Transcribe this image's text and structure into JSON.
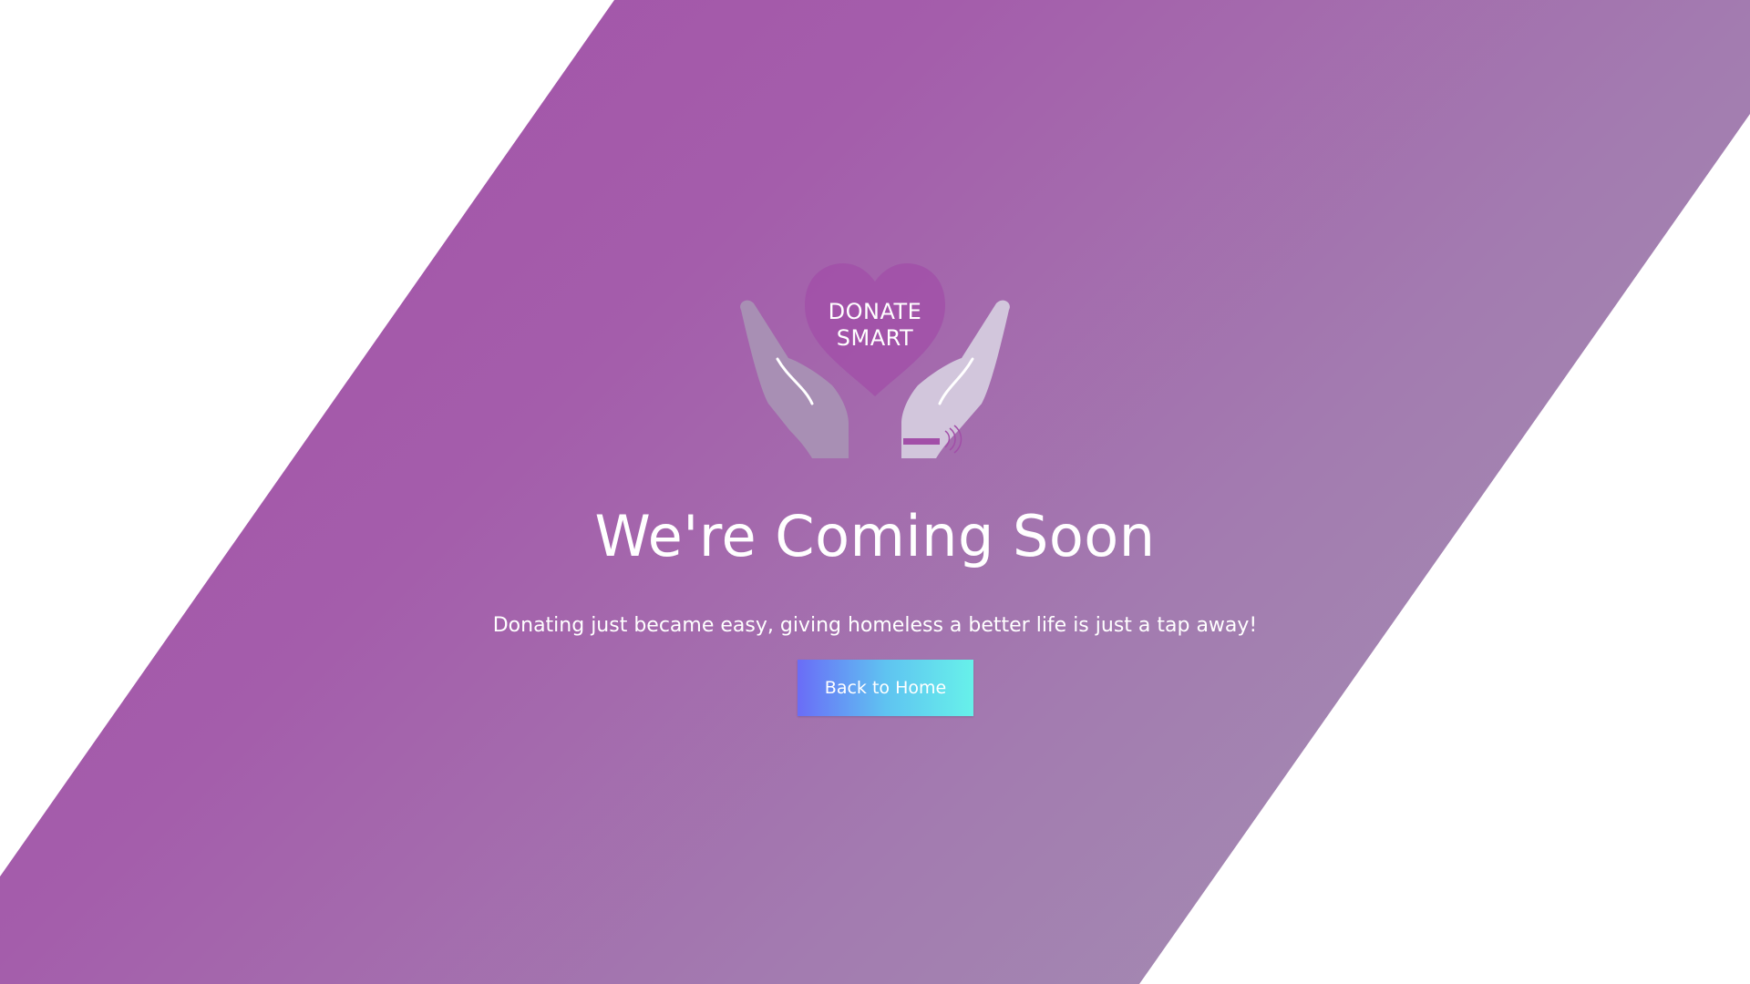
{
  "logo": {
    "line1": "DONATE",
    "line2": "SMART",
    "icon": "hands-holding-heart-icon"
  },
  "title": "We're Coming Soon",
  "subtitle": "Donating just became easy, giving homeless a better life is just a tap away!",
  "button": {
    "label": "Back to Home"
  },
  "colors": {
    "band_start": "#a24fa8",
    "band_end": "#a497b3",
    "button_start": "#6a6cf7",
    "button_end": "#67f1ea",
    "text": "#ffffff"
  }
}
